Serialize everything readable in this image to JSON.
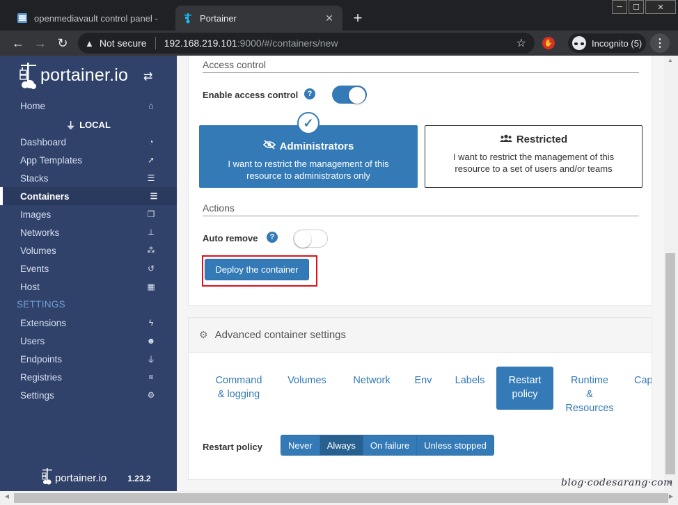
{
  "browser": {
    "tabs": [
      {
        "title": "openmediavault control panel - ",
        "active": false
      },
      {
        "title": "Portainer",
        "active": true
      }
    ],
    "new_tab": "+",
    "window_controls": {
      "minimize": "─",
      "maximize": "☐",
      "close": "✕"
    },
    "security": "Not secure",
    "url_host": "192.168.219.101",
    "url_path": ":9000/#/containers/new",
    "incognito_label": "Incognito (5)",
    "extension_badge": "✋"
  },
  "sidebar": {
    "brand": "portainer.io",
    "endpoint": "LOCAL",
    "nav": [
      {
        "label": "Home",
        "icon": "home-icon"
      },
      {
        "label": "Dashboard",
        "icon": "tachometer-icon"
      },
      {
        "label": "App Templates",
        "icon": "rocket-icon"
      },
      {
        "label": "Stacks",
        "icon": "th-list-icon"
      },
      {
        "label": "Containers",
        "icon": "server-icon",
        "active": true
      },
      {
        "label": "Images",
        "icon": "clone-icon"
      },
      {
        "label": "Networks",
        "icon": "sitemap-icon"
      },
      {
        "label": "Volumes",
        "icon": "cubes-icon"
      },
      {
        "label": "Events",
        "icon": "history-icon"
      },
      {
        "label": "Host",
        "icon": "th-icon"
      }
    ],
    "settings_heading": "SETTINGS",
    "settings": [
      {
        "label": "Extensions",
        "icon": "bolt-icon"
      },
      {
        "label": "Users",
        "icon": "users-icon"
      },
      {
        "label": "Endpoints",
        "icon": "plug-icon"
      },
      {
        "label": "Registries",
        "icon": "database-icon"
      },
      {
        "label": "Settings",
        "icon": "cogs-icon"
      }
    ],
    "footer_brand": "portainer.io",
    "version": "1.23.2"
  },
  "access_control": {
    "section_title": "Access control",
    "enable_label": "Enable access control",
    "enabled": true,
    "admin_title": "Administrators",
    "admin_desc": "I want to restrict the management of this resource to administrators only",
    "restricted_title": "Restricted",
    "restricted_desc": "I want to restrict the management of this resource to a set of users and/or teams",
    "selected": "Administrators"
  },
  "actions": {
    "section_title": "Actions",
    "auto_remove_label": "Auto remove",
    "auto_remove": false,
    "deploy_label": "Deploy the container"
  },
  "advanced": {
    "title": "Advanced container settings",
    "tabs": [
      {
        "line1": "Command",
        "line2": "& logging",
        "line3": ""
      },
      {
        "line1": "Volumes",
        "line2": "",
        "line3": ""
      },
      {
        "line1": "Network",
        "line2": "",
        "line3": ""
      },
      {
        "line1": "Env",
        "line2": "",
        "line3": ""
      },
      {
        "line1": "Labels",
        "line2": "",
        "line3": ""
      },
      {
        "line1": "Restart",
        "line2": "policy",
        "line3": "",
        "active": true
      },
      {
        "line1": "Runtime",
        "line2": "&",
        "line3": "Resources"
      },
      {
        "line1": "Capab",
        "line2": "",
        "line3": ""
      }
    ],
    "restart_label": "Restart policy",
    "restart_options": [
      "Never",
      "Always",
      "On failure",
      "Unless stopped"
    ],
    "restart_selected": "Always"
  },
  "watermark": "blog·codesarang·com",
  "colors": {
    "sidebar": "#30426a",
    "primary": "#337ab7",
    "highlight": "#e0101a"
  }
}
